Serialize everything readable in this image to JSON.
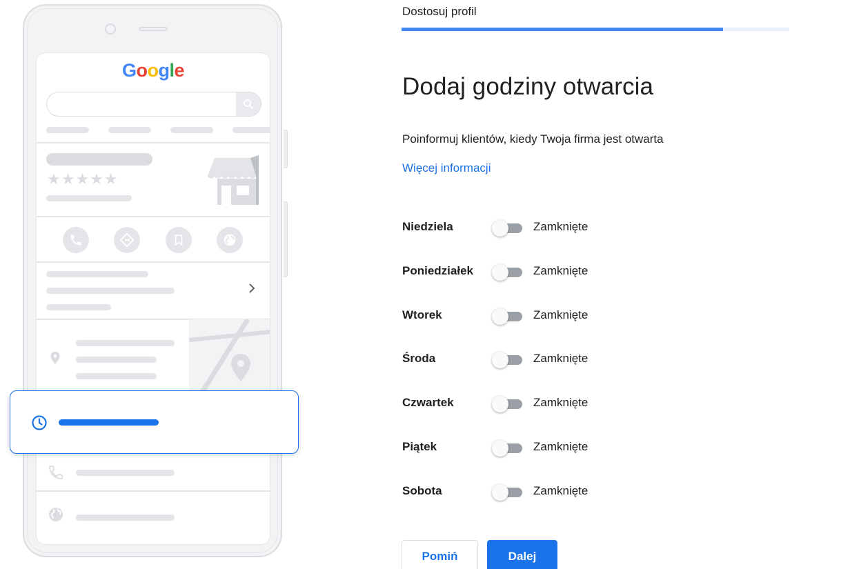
{
  "illustration": {
    "brand_letters": [
      {
        "char": "G",
        "color": "#4285F4"
      },
      {
        "char": "o",
        "color": "#EA4335"
      },
      {
        "char": "o",
        "color": "#FBBC05"
      },
      {
        "char": "g",
        "color": "#4285F4"
      },
      {
        "char": "l",
        "color": "#34A853"
      },
      {
        "char": "e",
        "color": "#EA4335"
      }
    ],
    "rating_stars": "★★★★★",
    "action_icons": [
      "phone-icon",
      "directions-icon",
      "bookmark-icon",
      "globe-icon"
    ],
    "hours_card_icon": "clock-icon",
    "accent_color": "#1a73e8"
  },
  "header": {
    "step_label": "Dostosuj profil",
    "progress_percent": 83
  },
  "main": {
    "title": "Dodaj godziny otwarcia",
    "description": "Poinformuj klientów, kiedy Twoja firma jest otwarta",
    "more_info_link": "Więcej informacji"
  },
  "days": [
    {
      "name": "Niedziela",
      "open": false,
      "status": "Zamknięte"
    },
    {
      "name": "Poniedziałek",
      "open": false,
      "status": "Zamknięte"
    },
    {
      "name": "Wtorek",
      "open": false,
      "status": "Zamknięte"
    },
    {
      "name": "Środa",
      "open": false,
      "status": "Zamknięte"
    },
    {
      "name": "Czwartek",
      "open": false,
      "status": "Zamknięte"
    },
    {
      "name": "Piątek",
      "open": false,
      "status": "Zamknięte"
    },
    {
      "name": "Sobota",
      "open": false,
      "status": "Zamknięte"
    }
  ],
  "actions": {
    "skip_label": "Pomiń",
    "next_label": "Dalej"
  }
}
